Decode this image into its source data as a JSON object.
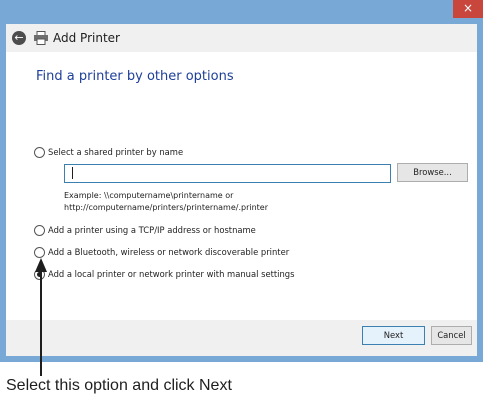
{
  "window": {
    "close_icon": "×",
    "title": "Add Printer",
    "back_icon": "←"
  },
  "page": {
    "heading": "Find a printer by other options",
    "options": [
      {
        "label": "Select a shared printer by name",
        "selected": false
      },
      {
        "label": "Add a printer using a TCP/IP address or hostname",
        "selected": false
      },
      {
        "label": "Add a Bluetooth, wireless or network discoverable printer",
        "selected": false
      },
      {
        "label": "Add a local printer or network printer with manual settings",
        "selected": true
      }
    ],
    "shared_name_input": {
      "value": "",
      "placeholder": ""
    },
    "browse_label": "Browse...",
    "example_line1": "Example: \\\\computername\\printername or",
    "example_line2": "http://computername/printers/printername/.printer"
  },
  "footer": {
    "next_label": "Next",
    "cancel_label": "Cancel"
  },
  "annotation": {
    "caption": "Select this option and click Next"
  },
  "colors": {
    "window_frame": "#78a8d6",
    "close_button": "#c9463d",
    "heading": "#1e3f99",
    "input_border": "#3c7fb1"
  }
}
